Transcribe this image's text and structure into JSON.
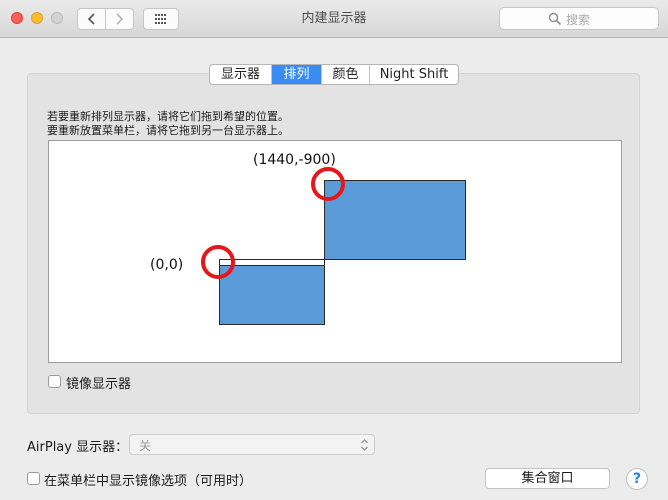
{
  "window": {
    "title": "内建显示器",
    "search_placeholder": "搜索"
  },
  "tabs": [
    {
      "label": "显示器",
      "active": false
    },
    {
      "label": "排列",
      "active": true
    },
    {
      "label": "颜色",
      "active": false
    },
    {
      "label": "Night Shift",
      "active": false
    }
  ],
  "instructions": {
    "line1": "若要重新排列显示器，请将它们拖到希望的位置。",
    "line2": "要重新放置菜单栏，请将它拖到另一台显示器上。"
  },
  "arrangement": {
    "main_display_coord": "(0,0)",
    "second_display_coord": "(1440,-900)"
  },
  "mirror": {
    "label": "镜像显示器",
    "checked": false
  },
  "airplay": {
    "label": "AirPlay 显示器：",
    "value": "关"
  },
  "menubar_option": {
    "label": "在菜单栏中显示镜像选项（可用时）",
    "checked": false
  },
  "gather_button": "集合窗口",
  "help_glyph": "?",
  "colors": {
    "accent": "#3b8cf2",
    "display_fill": "#5b9bd9",
    "highlight_ring": "#e6161b"
  }
}
